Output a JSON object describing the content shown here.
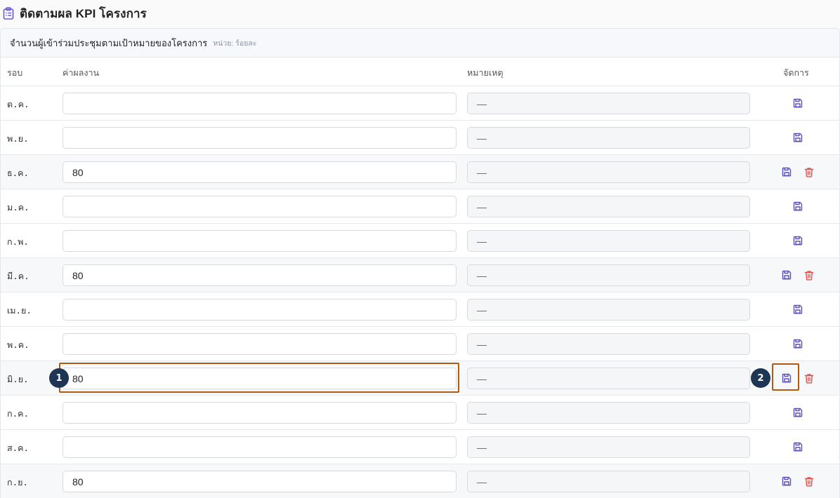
{
  "page": {
    "title": "ติดตามผล KPI โครงการ",
    "title_icon": "clipboard-list-icon"
  },
  "card": {
    "title": "จำนวนผู้เข้าร่วมประชุมตามเป้าหมายของโครงการ",
    "unit": "หน่วย: ร้อยละ"
  },
  "columns": {
    "round": "รอบ",
    "value": "ค่าผลงาน",
    "note": "หมายเหตุ",
    "actions": "จัดการ"
  },
  "rows": [
    {
      "round": "ต.ค.",
      "value": "",
      "note": "—",
      "saved": false
    },
    {
      "round": "พ.ย.",
      "value": "",
      "note": "—",
      "saved": false
    },
    {
      "round": "ธ.ค.",
      "value": "80",
      "note": "—",
      "saved": true
    },
    {
      "round": "ม.ค.",
      "value": "",
      "note": "—",
      "saved": false
    },
    {
      "round": "ก.พ.",
      "value": "",
      "note": "—",
      "saved": false
    },
    {
      "round": "มี.ค.",
      "value": "80",
      "note": "—",
      "saved": true
    },
    {
      "round": "เม.ย.",
      "value": "",
      "note": "—",
      "saved": false
    },
    {
      "round": "พ.ค.",
      "value": "",
      "note": "—",
      "saved": false
    },
    {
      "round": "มิ.ย.",
      "value": "80",
      "note": "—",
      "saved": true
    },
    {
      "round": "ก.ค.",
      "value": "",
      "note": "—",
      "saved": false
    },
    {
      "round": "ส.ค.",
      "value": "",
      "note": "—",
      "saved": false
    },
    {
      "round": "ก.ย.",
      "value": "80",
      "note": "—",
      "saved": true
    }
  ],
  "annotations": {
    "marker_1": "1",
    "marker_2": "2",
    "highlight_color": "#b15b10",
    "marker_color": "#1f3554"
  },
  "colors": {
    "save_icon": "#5b4fb8",
    "delete_icon": "#d9534f",
    "title_icon": "#6b5bd6"
  }
}
